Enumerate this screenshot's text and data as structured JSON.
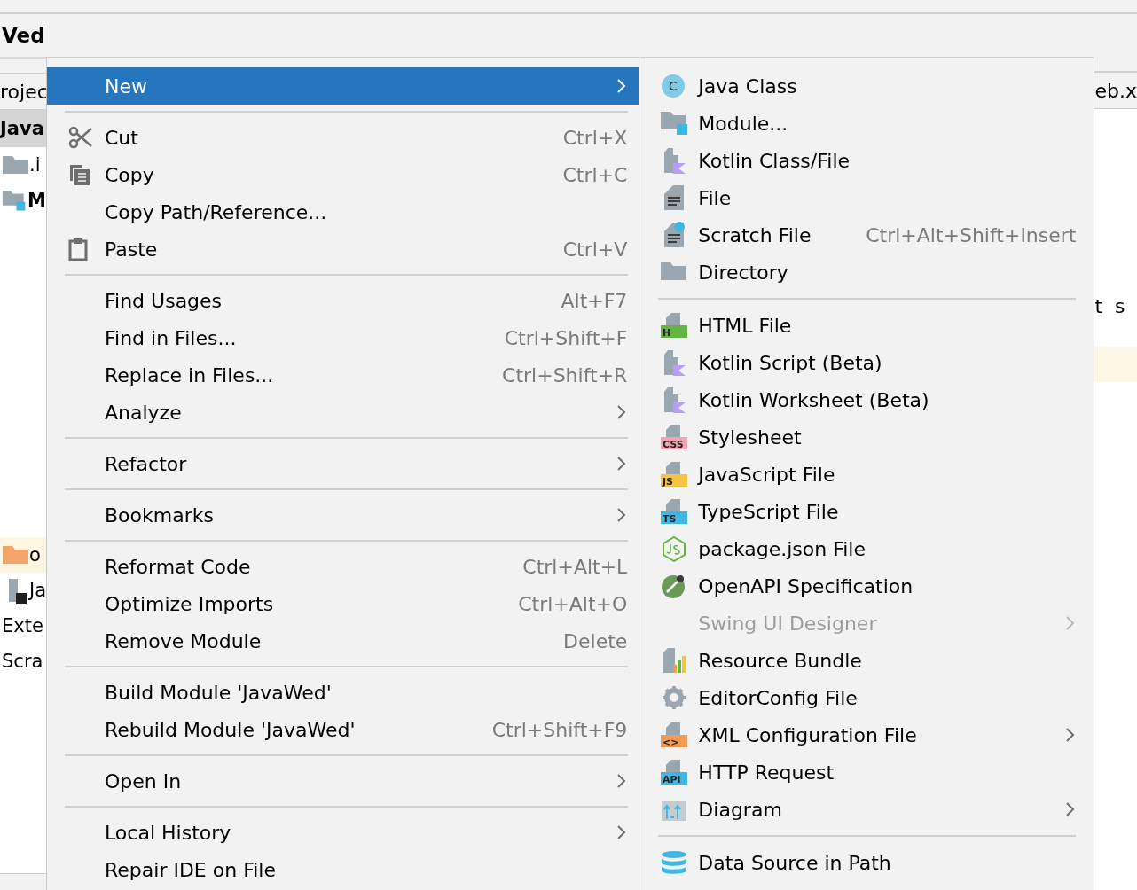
{
  "window": {
    "title": "Ved"
  },
  "project_bar": {
    "label": "rojec"
  },
  "tree": [
    {
      "text": "Java",
      "bold": true,
      "selected": true,
      "highlighted": false
    },
    {
      "text": ".i",
      "bold": false,
      "selected": false,
      "highlighted": false
    },
    {
      "text": "M",
      "bold": true,
      "selected": false,
      "highlighted": false
    },
    {
      "text": "o",
      "bold": false,
      "selected": false,
      "highlighted": true
    },
    {
      "text": "Ja",
      "bold": false,
      "selected": false,
      "highlighted": false
    },
    {
      "text": "Exte",
      "bold": false,
      "selected": false,
      "highlighted": false
    },
    {
      "text": "Scra",
      "bold": false,
      "selected": false,
      "highlighted": false
    }
  ],
  "editor": {
    "tab": "eb.x",
    "code_line": "t  s"
  },
  "menu": {
    "items": [
      {
        "kind": "item",
        "label": "New",
        "submenu": true,
        "selected": true
      },
      {
        "kind": "separator"
      },
      {
        "kind": "item",
        "label": "Cut",
        "submenu": false,
        "selected": false,
        "shortcut": "Ctrl+X"
      },
      {
        "kind": "item",
        "label": "Copy",
        "submenu": false,
        "selected": false,
        "shortcut": "Ctrl+C"
      },
      {
        "kind": "item",
        "label": "Copy Path/Reference...",
        "submenu": false,
        "selected": false
      },
      {
        "kind": "item",
        "label": "Paste",
        "submenu": false,
        "selected": false,
        "shortcut": "Ctrl+V"
      },
      {
        "kind": "separator"
      },
      {
        "kind": "item",
        "label": "Find Usages",
        "submenu": false,
        "selected": false,
        "shortcut": "Alt+F7"
      },
      {
        "kind": "item",
        "label": "Find in Files...",
        "submenu": false,
        "selected": false,
        "shortcut": "Ctrl+Shift+F"
      },
      {
        "kind": "item",
        "label": "Replace in Files...",
        "submenu": false,
        "selected": false,
        "shortcut": "Ctrl+Shift+R"
      },
      {
        "kind": "item",
        "label": "Analyze",
        "submenu": true,
        "selected": false
      },
      {
        "kind": "separator"
      },
      {
        "kind": "item",
        "label": "Refactor",
        "submenu": true,
        "selected": false
      },
      {
        "kind": "separator"
      },
      {
        "kind": "item",
        "label": "Bookmarks",
        "submenu": true,
        "selected": false
      },
      {
        "kind": "separator"
      },
      {
        "kind": "item",
        "label": "Reformat Code",
        "submenu": false,
        "selected": false,
        "shortcut": "Ctrl+Alt+L"
      },
      {
        "kind": "item",
        "label": "Optimize Imports",
        "submenu": false,
        "selected": false,
        "shortcut": "Ctrl+Alt+O"
      },
      {
        "kind": "item",
        "label": "Remove Module",
        "submenu": false,
        "selected": false,
        "shortcut": "Delete"
      },
      {
        "kind": "separator"
      },
      {
        "kind": "item",
        "label": "Build Module 'JavaWed'",
        "submenu": false,
        "selected": false
      },
      {
        "kind": "item",
        "label": "Rebuild Module 'JavaWed'",
        "submenu": false,
        "selected": false,
        "shortcut": "Ctrl+Shift+F9"
      },
      {
        "kind": "separator"
      },
      {
        "kind": "item",
        "label": "Open In",
        "submenu": true,
        "selected": false
      },
      {
        "kind": "separator"
      },
      {
        "kind": "item",
        "label": "Local History",
        "submenu": true,
        "selected": false
      },
      {
        "kind": "item",
        "label": "Repair IDE on File",
        "submenu": false,
        "selected": false
      }
    ]
  },
  "submenu": {
    "items": [
      {
        "kind": "item",
        "label": "Java Class",
        "badge": "C",
        "submenu": false,
        "disabled": false
      },
      {
        "kind": "item",
        "label": "Module...",
        "submenu": false,
        "disabled": false
      },
      {
        "kind": "item",
        "label": "Kotlin Class/File",
        "submenu": false,
        "disabled": false
      },
      {
        "kind": "item",
        "label": "File",
        "submenu": false,
        "disabled": false
      },
      {
        "kind": "item",
        "label": "Scratch File",
        "shortcut": "Ctrl+Alt+Shift+Insert",
        "submenu": false,
        "disabled": false
      },
      {
        "kind": "item",
        "label": "Directory",
        "submenu": false,
        "disabled": false
      },
      {
        "kind": "separator"
      },
      {
        "kind": "item",
        "label": "HTML File",
        "badge": "H",
        "submenu": false,
        "disabled": false
      },
      {
        "kind": "item",
        "label": "Kotlin Script (Beta)",
        "submenu": false,
        "disabled": false
      },
      {
        "kind": "item",
        "label": "Kotlin Worksheet (Beta)",
        "submenu": false,
        "disabled": false
      },
      {
        "kind": "item",
        "label": "Stylesheet",
        "badge": "CSS",
        "submenu": false,
        "disabled": false
      },
      {
        "kind": "item",
        "label": "JavaScript File",
        "badge": "JS",
        "submenu": false,
        "disabled": false
      },
      {
        "kind": "item",
        "label": "TypeScript File",
        "badge": "TS",
        "submenu": false,
        "disabled": false
      },
      {
        "kind": "item",
        "label": "package.json File",
        "submenu": false,
        "disabled": false
      },
      {
        "kind": "item",
        "label": "OpenAPI Specification",
        "submenu": false,
        "disabled": false
      },
      {
        "kind": "item",
        "label": "Swing UI Designer",
        "submenu": true,
        "disabled": true
      },
      {
        "kind": "item",
        "label": "Resource Bundle",
        "submenu": false,
        "disabled": false
      },
      {
        "kind": "item",
        "label": "EditorConfig File",
        "submenu": false,
        "disabled": false
      },
      {
        "kind": "item",
        "label": "XML Configuration File",
        "badge": "<>",
        "submenu": true,
        "disabled": false
      },
      {
        "kind": "item",
        "label": "HTTP Request",
        "badge": "API",
        "submenu": false,
        "disabled": false
      },
      {
        "kind": "item",
        "label": "Diagram",
        "submenu": true,
        "disabled": false
      },
      {
        "kind": "separator"
      },
      {
        "kind": "item",
        "label": "Data Source in Path",
        "submenu": false,
        "disabled": false
      }
    ]
  }
}
